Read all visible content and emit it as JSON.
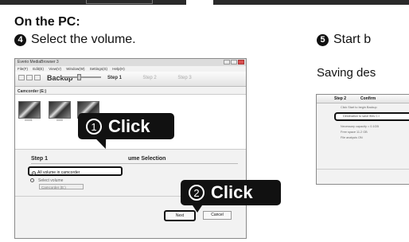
{
  "left_heading": "On the PC:",
  "step4": {
    "num": "4",
    "text": "Select the volume."
  },
  "step5": {
    "num": "5",
    "text": "Start b"
  },
  "saving_text": "Saving des",
  "app": {
    "title": "Everio MediaBrowser 3",
    "menu": [
      "File(F)",
      "Edit(E)",
      "View(V)",
      "Window(W)",
      "Settings(S)",
      "Help(H)"
    ],
    "toolbar": {
      "backup": "Backup",
      "step1": "Step 1",
      "step2": "Step 2",
      "step3": "Step 3"
    },
    "camcorder_label": "Camcorder (E:)",
    "thumbs": [
      "00001",
      "0000",
      ""
    ],
    "selection_title": "Step 1",
    "selection_title_right": "ume Selection",
    "option_all": "All volume in camcorder",
    "option_select": "Select volume",
    "camcorder_dropdown": "Camcorder (E:)",
    "next": "Next",
    "cancel": "Cancel"
  },
  "callout1": {
    "num": "1",
    "label": "Click"
  },
  "callout2": {
    "num": "2",
    "label": "Click"
  },
  "right_window": {
    "step2": "Step 2",
    "confirm": "Confirm",
    "line1": "Click Start to begin Backup",
    "dest": "Destination to save files C:\\",
    "capacity": "Necessary capacity = 0.1GB",
    "free_space": "Free space 11.2 GB",
    "analysis": "File analysis ON"
  }
}
